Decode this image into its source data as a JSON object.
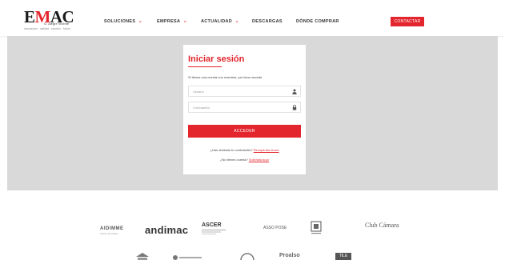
{
  "header": {
    "logo": {
      "text_prefix": "E",
      "text_accent": "M",
      "text_suffix": "AC",
      "subtitle": "G. Alegre Vicente",
      "tagline": "innovación · calidad · servicio · futuro"
    },
    "nav": [
      {
        "label": "SOLUCIONES",
        "has_dropdown": true
      },
      {
        "label": "EMPRESA",
        "has_dropdown": true
      },
      {
        "label": "ACTUALIDAD",
        "has_dropdown": true
      },
      {
        "label": "DESCARGAS",
        "has_dropdown": false
      },
      {
        "label": "DÓNDE COMPRAR",
        "has_dropdown": false
      }
    ],
    "contact_label": "CONTACTAR"
  },
  "login": {
    "title": "Iniciar sesión",
    "description": "Si tienes una cuenta con nosotros, por favor accede.",
    "username_placeholder": "Usuario",
    "password_placeholder": "Contraseña",
    "submit_label": "ACCEDER",
    "forgot_text": "¿Has olvidado tu contraseña?",
    "forgot_link": "Recupérala ahora",
    "register_text": "¿No tienes cuenta?",
    "register_link": "Solicítala aquí"
  },
  "partners": {
    "row1": [
      {
        "name": "AIDIMME",
        "sub": "Instituto Tecnológico"
      },
      {
        "name": "andimac"
      },
      {
        "name": "ASCER"
      },
      {
        "name": "ASSO POSE"
      },
      {
        "name": "emblem"
      },
      {
        "name": "Club Cámara"
      }
    ],
    "row2": [
      "Proalso",
      "TILE"
    ]
  },
  "colors": {
    "accent": "#e3262d",
    "band": "#d9d9d9",
    "text": "#333333"
  }
}
